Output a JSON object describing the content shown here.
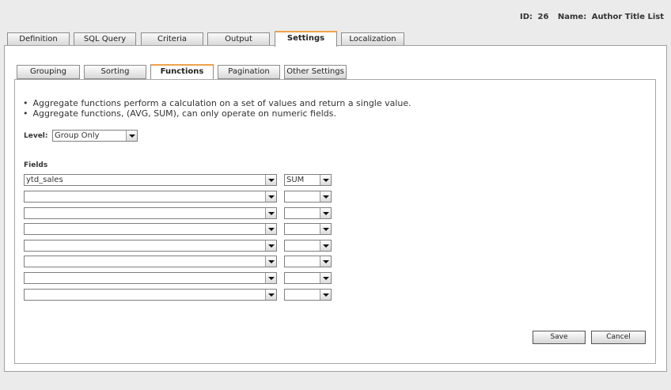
{
  "header": {
    "id_label": "ID:",
    "id_value": "26",
    "name_label": "Name:",
    "name_value": "Author Title List"
  },
  "main_tabs": [
    {
      "label": "Definition"
    },
    {
      "label": "SQL Query"
    },
    {
      "label": "Criteria"
    },
    {
      "label": "Output"
    },
    {
      "label": "Settings"
    },
    {
      "label": "Localization"
    }
  ],
  "active_main_tab": "Settings",
  "sub_tabs": [
    {
      "label": "Grouping"
    },
    {
      "label": "Sorting"
    },
    {
      "label": "Functions"
    },
    {
      "label": "Pagination"
    },
    {
      "label": "Other Settings"
    }
  ],
  "active_sub_tab": "Functions",
  "notes": [
    "Aggregate functions perform a calculation on a set of values and return a single value.",
    "Aggregate functions, (AVG, SUM), can only operate on numeric fields."
  ],
  "level": {
    "label": "Level:",
    "value": "Group Only"
  },
  "fields_label": "Fields",
  "field_rows": [
    {
      "field": "ytd_sales",
      "function": "SUM"
    },
    {
      "field": "",
      "function": ""
    },
    {
      "field": "",
      "function": ""
    },
    {
      "field": "",
      "function": ""
    },
    {
      "field": "",
      "function": ""
    },
    {
      "field": "",
      "function": ""
    },
    {
      "field": "",
      "function": ""
    },
    {
      "field": "",
      "function": ""
    }
  ],
  "buttons": {
    "save": "Save",
    "cancel": "Cancel"
  }
}
